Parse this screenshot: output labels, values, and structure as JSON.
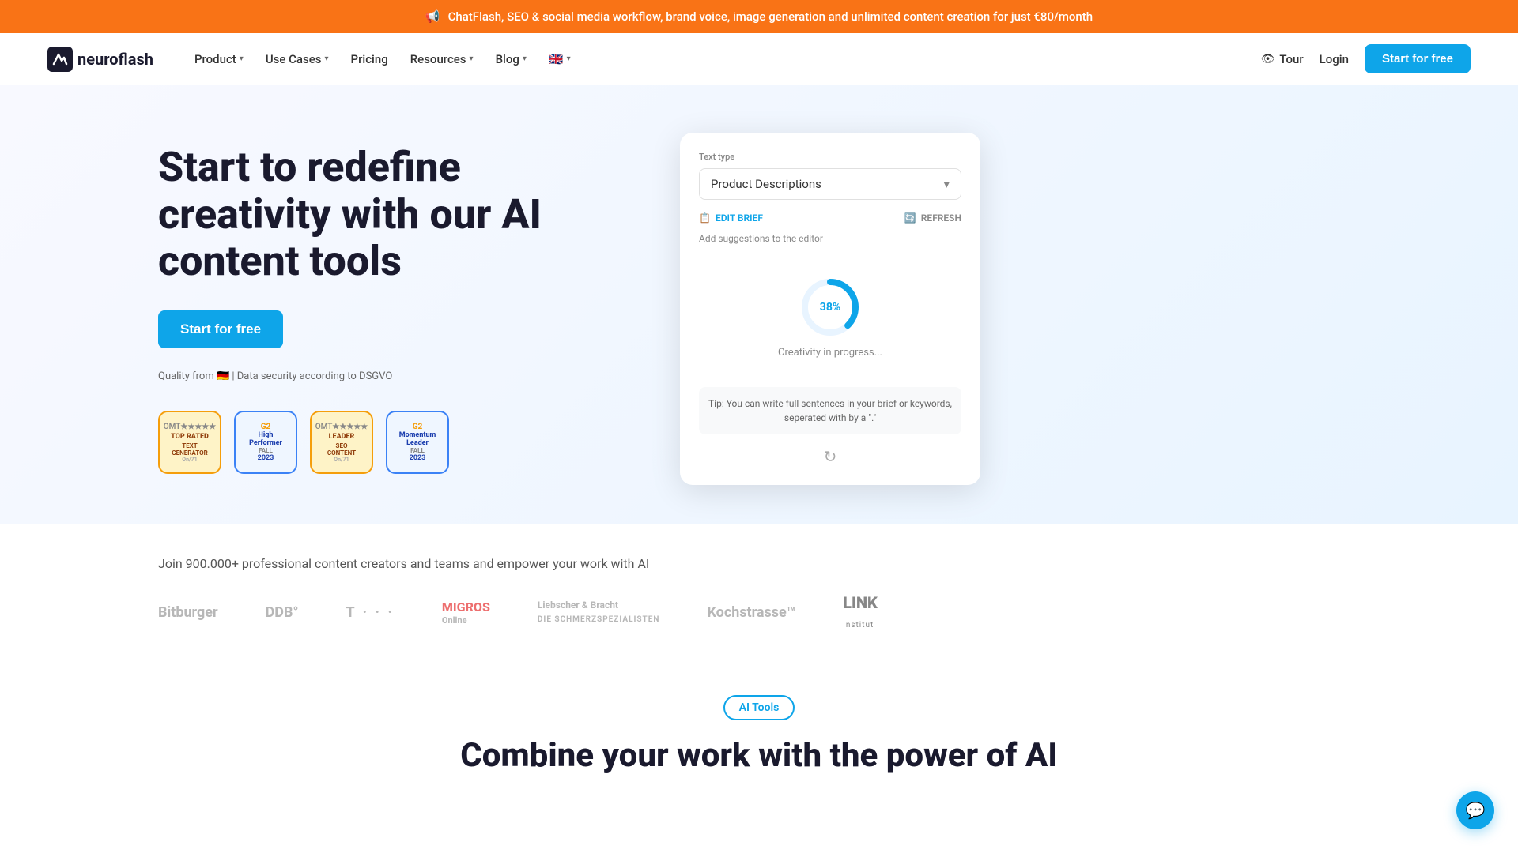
{
  "banner": {
    "icon": "📢",
    "text": "ChatFlash, SEO & social media workflow, brand voice, image generation and unlimited content creation for just €80/month"
  },
  "nav": {
    "logo_text": "neuroflash",
    "items": [
      {
        "label": "Product",
        "has_dropdown": true
      },
      {
        "label": "Use Cases",
        "has_dropdown": true
      },
      {
        "label": "Pricing",
        "has_dropdown": false
      },
      {
        "label": "Resources",
        "has_dropdown": true
      },
      {
        "label": "Blog",
        "has_dropdown": true
      }
    ],
    "flag": "🇬🇧",
    "tour_label": "Tour",
    "login_label": "Login",
    "start_free_label": "Start for free"
  },
  "hero": {
    "title": "Start to redefine creativity with our AI content tools",
    "cta_label": "Start for free",
    "quality_text": "Quality from 🇩🇪 | Data security according to DSGVO",
    "badges": [
      {
        "line1": "OMT★★★★★",
        "line2": "TOP RATED",
        "line3": "TEXT GENERATOR",
        "type": "orange"
      },
      {
        "line1": "G2",
        "line2": "High Performer",
        "line3": "FALL 2023",
        "type": "blue"
      },
      {
        "line1": "OMT★★★★★",
        "line2": "LEADER",
        "line3": "SEO CONTENT",
        "type": "orange"
      },
      {
        "line1": "G2",
        "line2": "Momentum Leader",
        "line3": "FALL 2023",
        "type": "blue"
      }
    ]
  },
  "demo_card": {
    "text_type_label": "Text type",
    "selected_type": "Product Descriptions",
    "edit_brief_label": "EDIT BRIEF",
    "refresh_label": "REFRESH",
    "add_suggestions_label": "Add suggestions to the editor",
    "progress_percent": "38%",
    "creativity_label": "Creativity in progress...",
    "tip_text": "Tip: You can write full sentences in your brief or keywords, seperated with by a \".\"",
    "select_placeholder": "Product Descriptions"
  },
  "social_proof": {
    "join_text": "Join 900.000+ professional content creators and teams and empower your work with AI",
    "brands": [
      "Bitburger",
      "DDB°",
      "T · · ·",
      "MIGROS Online",
      "Liebscher & Bracht DIE SCHMERZSPEZIALISTEN",
      "Kochstrasse™",
      "LINK Institut"
    ]
  },
  "ai_tools_section": {
    "badge_label": "AI Tools",
    "section_title": "Combine your work with the power of AI"
  },
  "colors": {
    "orange": "#F97316",
    "blue": "#0EA5E9",
    "dark": "#1a1a2e"
  }
}
